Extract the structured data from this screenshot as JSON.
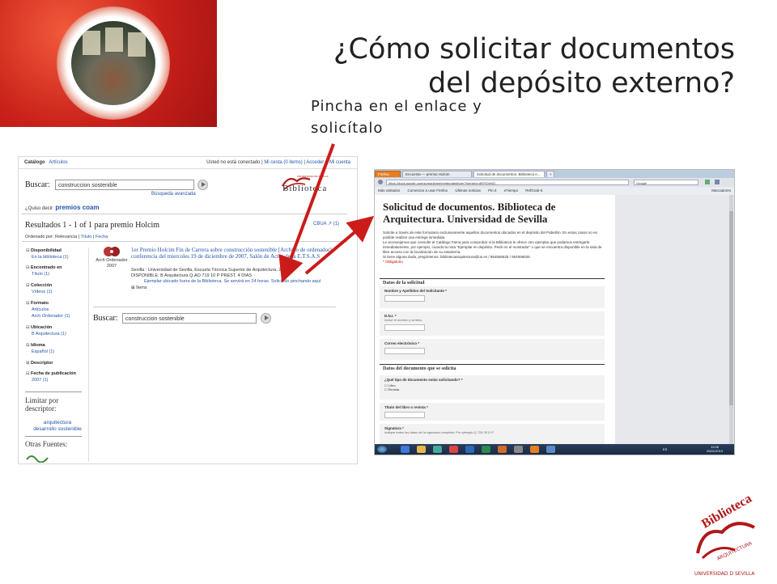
{
  "slide": {
    "title": "¿Cómo solicitar documentos del depósito externo?",
    "instruction": "Pincha en el enlace y solicítalo"
  },
  "catalog": {
    "tabs": [
      "Catálogo",
      "Artículos"
    ],
    "user_status": "Usted no está conectado",
    "cesta": "Mi cesta (0 items)",
    "login": "Acceder a Mi cuenta",
    "search_label": "Buscar:",
    "search_value": "construccion sostenible",
    "advanced": "Búsqueda avanzada",
    "did_you_mean": "¿Quiso decir:",
    "suggestion": "premios coam",
    "results_header": "Resultados 1 - 1 of 1 para premio Holcim",
    "sort": "Ordenado por:",
    "sort_options": [
      "Relevancia",
      "Título",
      "Fecha"
    ],
    "cbua": "CBUA",
    "cbua_count": "(1)",
    "facets": [
      {
        "label": "Disponibilidad",
        "value": "En la biblioteca (1)"
      },
      {
        "label": "Encontrado en",
        "value": "Título (1)"
      },
      {
        "label": "Colección",
        "value": "Vídeos (1)"
      },
      {
        "label": "Formato",
        "value": "Artículos",
        "value2": "Arch Ordenador (1)"
      },
      {
        "label": "Ubicación",
        "value": "B Arquitectura (1)"
      },
      {
        "label": "Idioma",
        "value": "Español (1)"
      },
      {
        "label": "Descriptor",
        "value": ""
      },
      {
        "label": "Fecha de publicación",
        "value": "2007 (1)"
      }
    ],
    "limit_title": "Limitar por descriptor:",
    "limit_links": [
      "arquitectura",
      "desarrollo sostenible"
    ],
    "other_sources": "Otras Fuentes:",
    "result": {
      "type_label": "Arch Ordenador",
      "year": "2007",
      "title": "1er Premio Holcim Fin de Carrera sobre construcción sostenible [Archivo de ordenador] : conferencia del miercoles 19 de diciembre de 2007, Salón de Actos de la E.T.S.A.S",
      "publisher": "Sevilla : Universidad de Sevilla, Escuela Técnica Superior de Arquitectura, 2007",
      "availability": "DISPONIBLE: B Arquitectura Q.AO 719 10 P PREST. 4 DIAS",
      "request_note": "Ejemplar ubicado fuera de la Biblioteca. Se servirá en 24 horas.",
      "request_link": "Solicítelo pinchando aquí",
      "items": "Ítems"
    },
    "logo_text": "Biblioteca",
    "logo_top": "UNIVERSIDAD DE SEVILLA"
  },
  "form": {
    "browser_tab1": "Encuesta — premio Holcim",
    "browser_tab2": "Solicitud de documentos. Biblioteca e...",
    "firefox": "Firefox",
    "url": "https://docs.google.com/spreadsheet/embeddedform?formkey=dEFtQnNQ...",
    "search_engine": "Google",
    "bookmarks": [
      "Más visitados",
      "Comenzar a usar Firefox",
      "Últimas noticias",
      "Pin It",
      "eTiempo",
      "RefGrab-It"
    ],
    "bookmarks_right": "Marcadores",
    "title": "Solicitud de documentos. Biblioteca de Arquitectura. Universidad de Sevilla",
    "desc1": "Solicite a través de este formulario exclusivamente aquellos documentos ubicados en el depósito del Pabellón. En estos casos no es posible realizar una entrega inmediata.",
    "desc2": "Le aconsejamos que consulte el Catálogo Fama para comprobar si la Biblioteca le ofrece otro ejemplar que podamos entregarle inmediatamente, por ejemplo, cuando la nota \"Ejemplar en depósito. Pedir en el mostrador\" o que se encuentra disponible en la sala de libre acceso con la localización de su estantería.",
    "desc3": "Si tiene alguna duda, pregúntenos: bibliotecaarquitectura@us.es / 954556525 / 954556526",
    "required": "* Obligatorio",
    "section1": "Datos de la solicitud",
    "q_name": "Nombre y Apellidos del Solicitante *",
    "q_dni": "D.N.I. *",
    "q_dni_help": "Incluir el número y la letra.",
    "q_email": "Correo electrónico *",
    "section2": "Datos del documento que se solicita",
    "q_type": "¿Qué tipo de documento estás solicitando? *",
    "opt1": "Libro",
    "opt2": "Revista",
    "q_title": "Título del libro o revista *",
    "q_sig": "Signatura *",
    "q_sig_help": "Indique todos los datos de la signatura completa. Por ejemplo Q 725.35 D P",
    "clock": "11:05",
    "date": "25/01/2013",
    "lang": "ES"
  },
  "logo": {
    "text": "Biblioteca",
    "sub": "ARQUITECTURA",
    "ring": "UNIVERSIDAD D SEVILLA"
  }
}
